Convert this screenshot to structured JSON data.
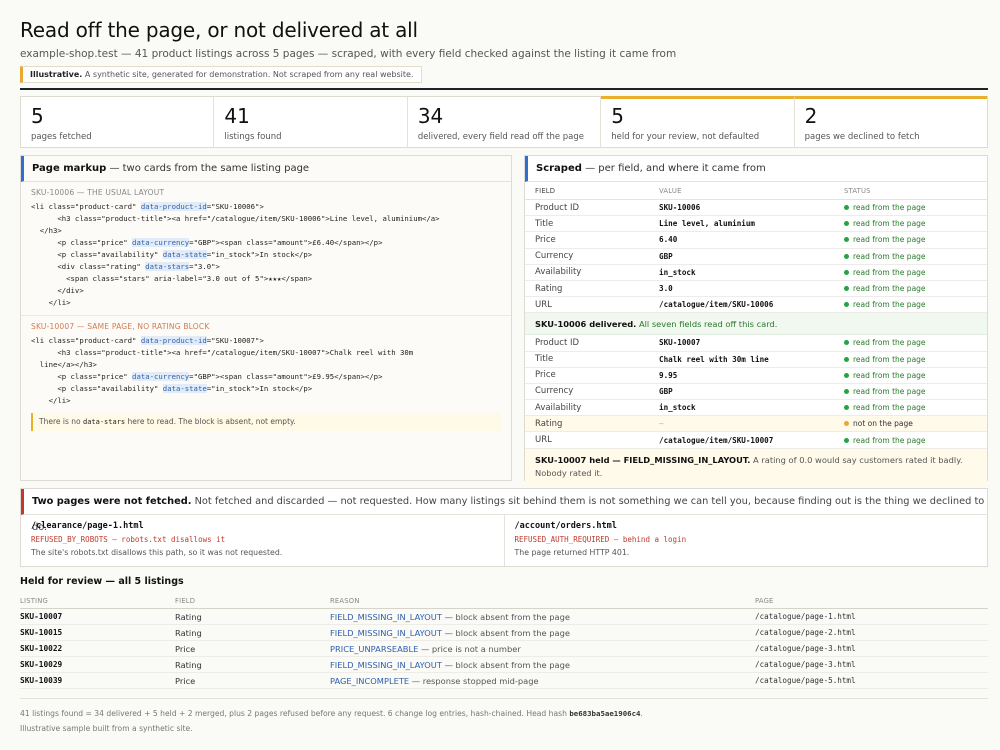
{
  "header": {
    "title": "Read off the page, or not delivered at all",
    "subtitle": "example-shop.test — 41 product listings across 5 pages — scraped, with every field checked against the listing it came from",
    "notice_bold": "Illustrative.",
    "notice_text": "A synthetic site, generated for demonstration. Not scraped from any real website."
  },
  "stats": [
    {
      "num": "5",
      "label": "pages fetched"
    },
    {
      "num": "41",
      "label": "listings found"
    },
    {
      "num": "34",
      "label": "delivered, every field read off the page"
    },
    {
      "num": "5",
      "label": "held for your review, not defaulted"
    },
    {
      "num": "2",
      "label": "pages we declined to fetch"
    }
  ],
  "markup": {
    "head_bold": "Page markup",
    "head_rest": "— two cards from the same listing page",
    "card1_caption": "SKU-10006 — THE USUAL LAYOUT",
    "card2_caption": "SKU-10007 — SAME PAGE, NO RATING BLOCK",
    "note_pre": "There is no",
    "note_code": "data-stars",
    "note_post": "here to read. The block is absent, not empty."
  },
  "scraped": {
    "head_bold": "Scraped",
    "head_rest": "— per field, and where it came from",
    "col_field": "FIELD",
    "col_value": "VALUE",
    "col_status": "STATUS",
    "card1": [
      {
        "field": "Product ID",
        "value": "SKU-10006",
        "status": "read from the page"
      },
      {
        "field": "Title",
        "value": "Line level, aluminium",
        "status": "read from the page"
      },
      {
        "field": "Price",
        "value": "6.40",
        "status": "read from the page"
      },
      {
        "field": "Currency",
        "value": "GBP",
        "status": "read from the page"
      },
      {
        "field": "Availability",
        "value": "in_stock",
        "status": "read from the page"
      },
      {
        "field": "Rating",
        "value": "3.0",
        "status": "read from the page"
      },
      {
        "field": "URL",
        "value": "/catalogue/item/SKU-10006",
        "status": "read from the page"
      }
    ],
    "delivered_bold": "SKU-10006 delivered.",
    "delivered_rest": "All seven fields read off this card.",
    "card2": [
      {
        "field": "Product ID",
        "value": "SKU-10007",
        "status": "read from the page"
      },
      {
        "field": "Title",
        "value": "Chalk reel with 30m line",
        "status": "read from the page"
      },
      {
        "field": "Price",
        "value": "9.95",
        "status": "read from the page"
      },
      {
        "field": "Currency",
        "value": "GBP",
        "status": "read from the page"
      },
      {
        "field": "Availability",
        "value": "in_stock",
        "status": "read from the page"
      },
      {
        "field": "Rating",
        "value": "–",
        "status": "not on the page"
      },
      {
        "field": "URL",
        "value": "/catalogue/item/SKU-10007",
        "status": "read from the page"
      }
    ],
    "held_bold": "SKU-10007 held — FIELD_MISSING_IN_LAYOUT.",
    "held_rest": "A rating of 0.0 would say customers rated it badly. Nobody rated it."
  },
  "refused": {
    "head_bold": "Two pages were not fetched.",
    "head_rest": "Not fetched and discarded — not requested. How many listings sit behind them is not something we can tell you, because finding out is the thing we declined to do.",
    "items": [
      {
        "path": "/clearance/page-1.html",
        "code": "REFUSED_BY_ROBOTS — robots.txt disallows it",
        "desc": "The site's robots.txt disallows this path, so it was not requested."
      },
      {
        "path": "/account/orders.html",
        "code": "REFUSED_AUTH_REQUIRED — behind a login",
        "desc": "The page returned HTTP 401."
      }
    ]
  },
  "held": {
    "title": "Held for review — all 5 listings",
    "cols": {
      "listing": "LISTING",
      "field": "FIELD",
      "reason": "REASON",
      "page": "PAGE"
    },
    "rows": [
      {
        "listing": "SKU-10007",
        "field": "Rating",
        "code": "FIELD_MISSING_IN_LAYOUT",
        "rest": "— block absent from the page",
        "page": "/catalogue/page-1.html"
      },
      {
        "listing": "SKU-10015",
        "field": "Rating",
        "code": "FIELD_MISSING_IN_LAYOUT",
        "rest": "— block absent from the page",
        "page": "/catalogue/page-2.html"
      },
      {
        "listing": "SKU-10022",
        "field": "Price",
        "code": "PRICE_UNPARSEABLE",
        "rest": "— price is not a number",
        "page": "/catalogue/page-3.html"
      },
      {
        "listing": "SKU-10029",
        "field": "Rating",
        "code": "FIELD_MISSING_IN_LAYOUT",
        "rest": "— block absent from the page",
        "page": "/catalogue/page-3.html"
      },
      {
        "listing": "SKU-10039",
        "field": "Price",
        "code": "PAGE_INCOMPLETE",
        "rest": "— response stopped mid-page",
        "page": "/catalogue/page-5.html"
      }
    ]
  },
  "footer": {
    "line1": "41 listings found = 34 delivered + 5 held + 2 merged, plus 2 pages refused before any request. 6 change log entries, hash-chained. Head hash",
    "hash": "be683ba5ae1906c4",
    "line1_end": ".",
    "line2": "Illustrative sample built from a synthetic site."
  }
}
